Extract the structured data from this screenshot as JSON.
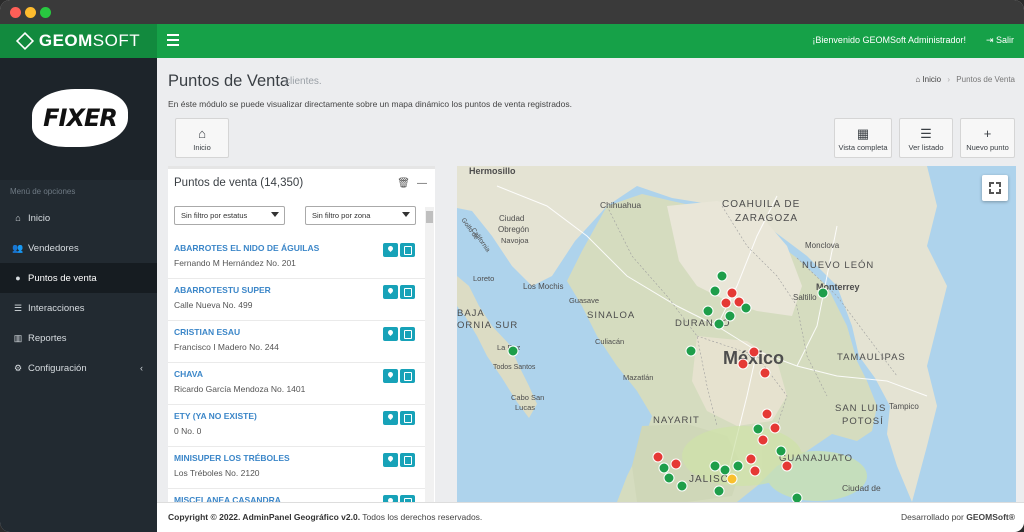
{
  "brand": {
    "bold": "GEOM",
    "light": "SOFT"
  },
  "header": {
    "welcome": "¡Bienvenido GEOMSoft Administrador!",
    "logout": "Salir"
  },
  "sidebar": {
    "logo_text": "FIXER",
    "caption": "Menú de opciones",
    "items": [
      {
        "label": "Inicio",
        "icon": "home-icon"
      },
      {
        "label": "Vendedores",
        "icon": "users-icon"
      },
      {
        "label": "Puntos de venta",
        "icon": "map-marker-icon"
      },
      {
        "label": "Interacciones",
        "icon": "list-icon"
      },
      {
        "label": "Reportes",
        "icon": "bar-chart-icon"
      },
      {
        "label": "Configuración",
        "icon": "gear-icon"
      }
    ]
  },
  "page": {
    "title": "Puntos de Venta",
    "subtitle": "clientes.",
    "description": "En éste módulo se puede visualizar directamente sobre un mapa dinámico los puntos de venta registrados.",
    "breadcrumb": {
      "home": "Inicio",
      "current": "Puntos de Venta"
    }
  },
  "toolbar": {
    "home": "Inicio",
    "full_view": "Vista completa",
    "list_view": "Ver listado",
    "new_point": "Nuevo punto"
  },
  "panel": {
    "title": "Puntos de venta (14,350)",
    "filter_status": "Sin filtro por estatus",
    "filter_zone": "Sin filtro por zona",
    "items": [
      {
        "name": "ABARROTES EL NIDO DE ÁGUILAS",
        "address": "Fernando M Hernández No. 201"
      },
      {
        "name": "ABARROTESTU SUPER",
        "address": "Calle Nueva No. 499"
      },
      {
        "name": "CRISTIAN ESAU",
        "address": "Francisco I Madero No. 244"
      },
      {
        "name": "CHAVA",
        "address": "Ricardo García Mendoza No. 1401"
      },
      {
        "name": "ETY (YA NO EXISTE)",
        "address": "0 No. 0"
      },
      {
        "name": "MINISUPER LOS TRÉBOLES",
        "address": "Los Tréboles No. 2120"
      },
      {
        "name": "MISCELANEA CASANDRA",
        "address": ""
      }
    ]
  },
  "map": {
    "labels": {
      "hermosillo": "Hermosillo",
      "coahuila1": "COAHUILA DE",
      "coahuila2": "ZARAGOZA",
      "chihuahua": "Chihuahua",
      "golfo1": "Golfo de",
      "golfo2": "California",
      "ciudad_obregon1": "Ciudad",
      "ciudad_obregon2": "Obregón",
      "navojoa": "Navojoa",
      "monclova": "Monclova",
      "nuevo_leon": "NUEVO LEÓN",
      "los_mochis": "Los Mochis",
      "saltillo": "Saltillo",
      "monterrey": "Monterrey",
      "loreto": "Loreto",
      "guasave": "Guasave",
      "baja1": "BAJA",
      "baja2": "ORNIA SUR",
      "sinaloa": "SINALOA",
      "durango": "DURANGO",
      "la_paz": "La Paz",
      "mexico": "México",
      "tamaulipas": "TAMAULIPAS",
      "culiacan": "Culiacán",
      "todos_santos": "Todos Santos",
      "mazatlan": "Mazatlán",
      "cabo1": "Cabo San",
      "cabo2": "Lucas",
      "nayarit": "NAYARIT",
      "tampico": "Tampico",
      "san_luis1": "SAN LUIS",
      "san_luis2": "POTOSÍ",
      "guanajuato": "GUANAJUATO",
      "jalisco": "JALISCO",
      "ciudad_de": "Ciudad de"
    }
  },
  "footer": {
    "copyright": "Copyright © 2022. AdminPanel Geográfico v2.0.",
    "rights": " Todos los derechos reservados.",
    "dev_prefix": "Desarrollado por ",
    "dev_name": "GEOMSoft®"
  }
}
